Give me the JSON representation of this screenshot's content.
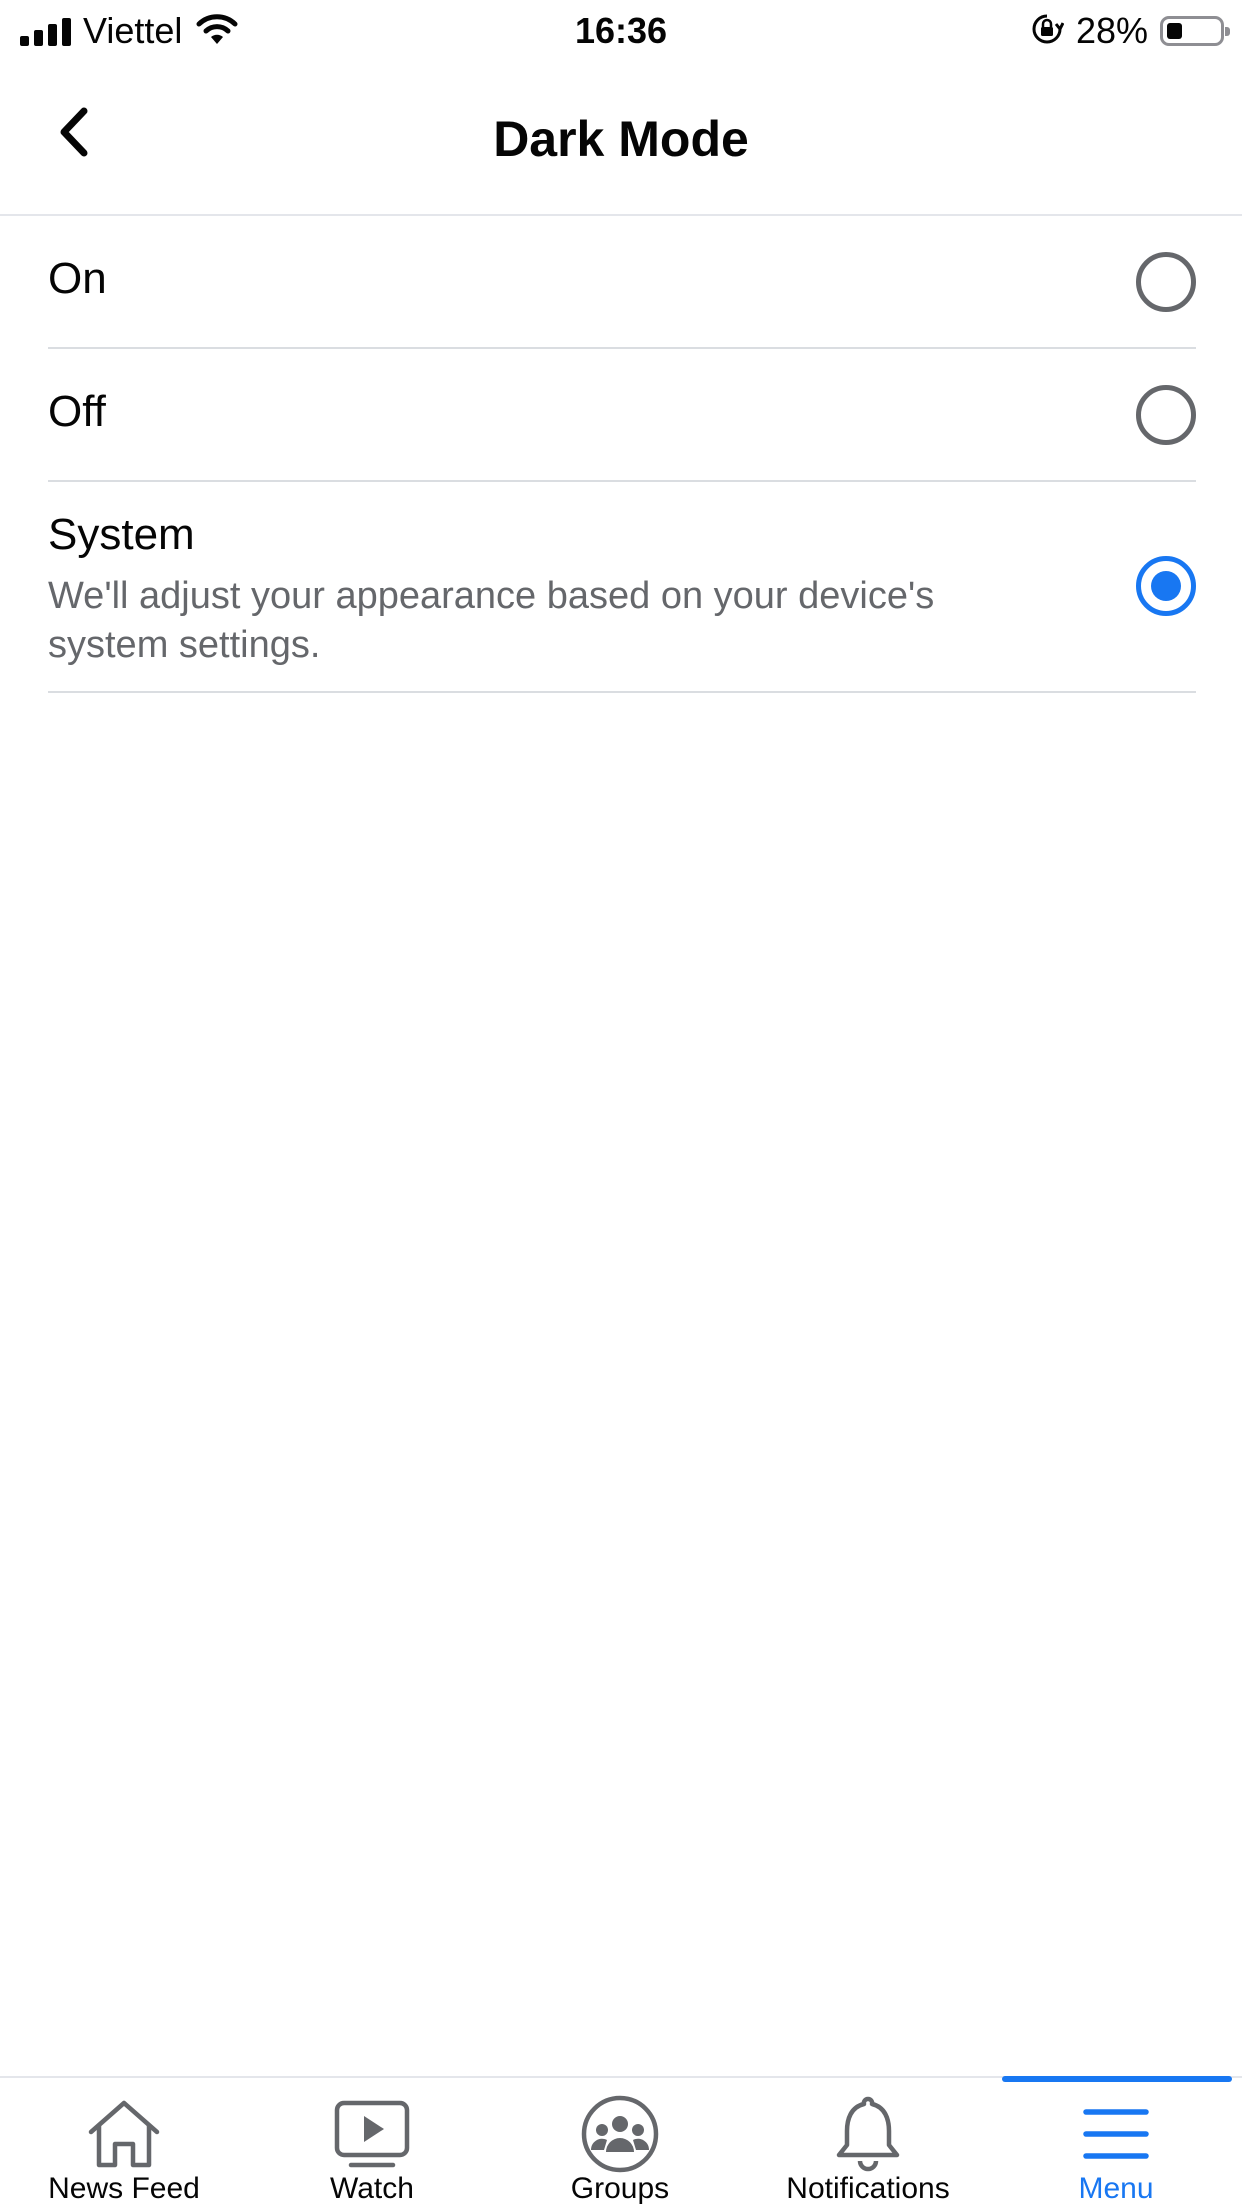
{
  "status_bar": {
    "carrier": "Viettel",
    "time": "16:36",
    "battery_percent": "28%",
    "battery_level": 0.28,
    "icons": [
      "signal-icon",
      "wifi-icon",
      "orientation-lock-icon",
      "battery-icon"
    ]
  },
  "header": {
    "title": "Dark Mode",
    "back_icon": "chevron-left-icon"
  },
  "options": [
    {
      "label": "On",
      "selected": false
    },
    {
      "label": "Off",
      "selected": false
    },
    {
      "label": "System",
      "description": "We'll adjust your appearance based on your device's system settings.",
      "selected": true
    }
  ],
  "tab_bar": {
    "active": "Menu",
    "items": [
      {
        "label": "News Feed",
        "icon": "home-icon"
      },
      {
        "label": "Watch",
        "icon": "watch-video-icon"
      },
      {
        "label": "Groups",
        "icon": "groups-icon"
      },
      {
        "label": "Notifications",
        "icon": "bell-icon"
      },
      {
        "label": "Menu",
        "icon": "hamburger-menu-icon"
      }
    ]
  },
  "colors": {
    "accent": "#1877f2",
    "text_primary": "#050505",
    "text_secondary": "#65676b",
    "divider": "#dadde1",
    "icon_gray": "#65676b"
  }
}
